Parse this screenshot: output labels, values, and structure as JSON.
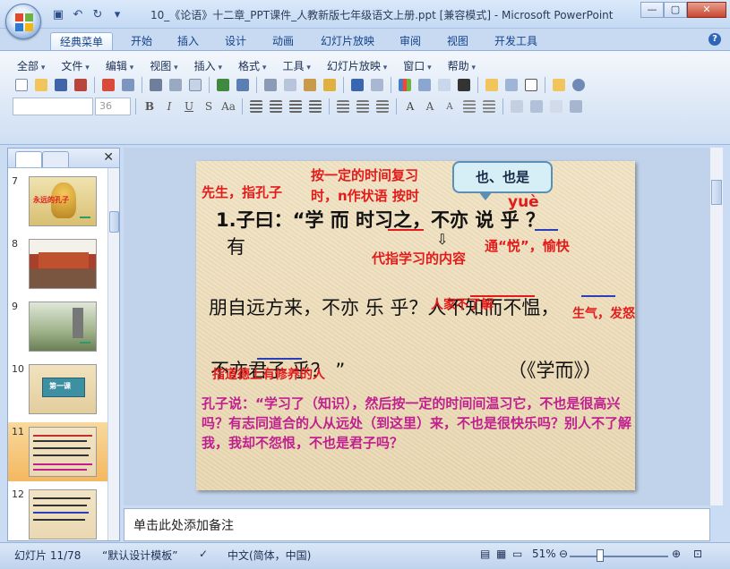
{
  "window": {
    "title": "10_《论语》十二章_PPT课件_人教新版七年级语文上册.ppt [兼容模式] - Microsoft PowerPoint",
    "minimize": "—",
    "maximize": "▢",
    "close": "✕"
  },
  "tabs": [
    "经典菜单",
    "开始",
    "插入",
    "设计",
    "动画",
    "幻灯片放映",
    "审阅",
    "视图",
    "开发工具"
  ],
  "menu": [
    "全部",
    "文件",
    "编辑",
    "视图",
    "插入",
    "格式",
    "工具",
    "幻灯片放映",
    "窗口",
    "帮助"
  ],
  "font_size": "36",
  "slide_numbers": [
    "7",
    "8",
    "9",
    "10",
    "11",
    "12"
  ],
  "thumbnails": {
    "t7_text": "永远的孔子",
    "t10_text": "第一课"
  },
  "slide": {
    "callout": "也、也是",
    "anno_teacher": "先生，指孔子",
    "anno_review": "按一定的时间复习",
    "anno_n": "时，n作状语 按时",
    "anno_yue": "yuè",
    "line1": "1.子曰：“学 而 时习之，不亦 说 乎 ？",
    "line1_you": "有",
    "anno_content": "代指学习的内容",
    "anno_yue_meaning": "通“悦”，愉快",
    "line2": "朋自远方来，不亦 乐 乎？人不知而不愠，",
    "anno_not_understand": "人家不了解",
    "anno_angry": "生气，发怒",
    "line3": "不亦君子 乎？ ”",
    "source": "（《学而》）",
    "anno_virtue": "指道德上有修养的人",
    "translation": "孔子说：“学习了（知识），然后按一定的时间间温习它，不也是很高兴吗？有志同道合的人从远处（到这里）来，不也是很快乐吗？别人不了解我，我却不怨恨，不也是君子吗？"
  },
  "notes_placeholder": "单击此处添加备注",
  "status": {
    "slide_info": "幻灯片 11/78",
    "template": "“默认设计模板”",
    "language": "中文(简体，中国)",
    "zoom": "51%"
  }
}
